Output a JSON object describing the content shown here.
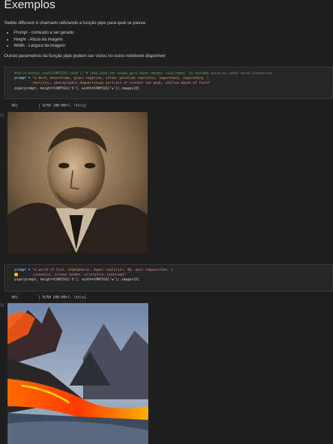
{
  "markdown": {
    "title": "Exemplos",
    "intro": "Stable diffusion é chamado utilizando a função pipe para qual se passa:",
    "bullets": [
      "Prompt - conteúdo a ser gerado",
      "Height - Altura da imagem",
      "Width - Largura da imagem"
    ],
    "outro": "Outras parametros da função pipe podem ser vistos no outro notebook disponível"
  },
  "cell1": {
    "line1": "#torch.manual_seed(CONFIGS['seed']) # Seed pode ser usada para obter mesmos resultados. Se deixada assim as seeds serao aleatorias",
    "line2_var": "prompt",
    "line2_rest": " = ",
    "line2_str": "\"a dark, monochrome, glass negative, silver gelatine realistic, supersharp, supersharp, \\",
    "line3_str": "realistic, photographic daguerrotype portrait of vincent van gogh, shallow depth of field\"",
    "line4": "pipe(prompt, height=CONFIGS['h'], width=CONFIGS['w']).images[0]"
  },
  "cell1_progress": "0%|          | 0/50 [00:00<?, ?it/s]",
  "cell2": {
    "line1_var": "prompt",
    "line1_rest": " = ",
    "line1_str": "\"A world of fire, atmospheric, hyper realistic, 8k, epic composition, \\",
    "line2_str": "cinematic, octane render, artstation landscape\"",
    "line3": "pipe(prompt, height=CONFIGS['h'], width=CONFIGS['w']).images[0]"
  },
  "cell2_progress": "0%|          | 0/50 [00:00<?, ?it/s]",
  "gutter": {
    "mark1": "[]",
    "mark2": "[]"
  }
}
